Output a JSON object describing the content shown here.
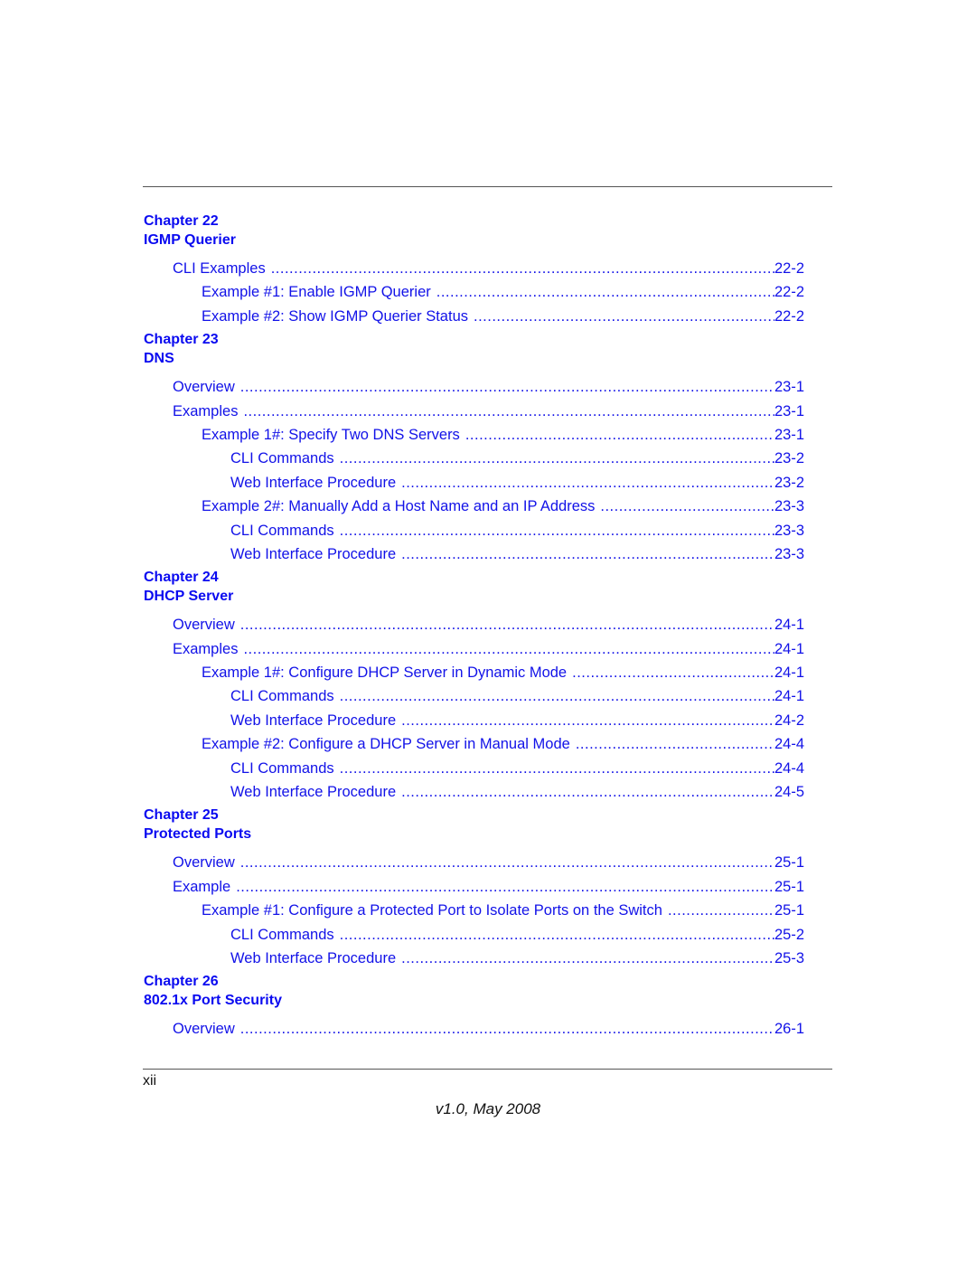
{
  "chapters": [
    {
      "chapter_label": "Chapter 22",
      "title": "IGMP Querier",
      "entries": [
        {
          "level": 1,
          "label": "CLI Examples",
          "page": "22-2"
        },
        {
          "level": 2,
          "label": "Example #1: Enable IGMP Querier",
          "page": "22-2"
        },
        {
          "level": 2,
          "label": "Example #2: Show IGMP Querier Status",
          "page": "22-2"
        }
      ]
    },
    {
      "chapter_label": "Chapter 23",
      "title": "DNS",
      "entries": [
        {
          "level": 1,
          "label": "Overview",
          "page": "23-1"
        },
        {
          "level": 1,
          "label": "Examples",
          "page": "23-1"
        },
        {
          "level": 2,
          "label": "Example 1#: Specify Two DNS Servers",
          "page": "23-1"
        },
        {
          "level": 3,
          "label": "CLI Commands",
          "page": "23-2"
        },
        {
          "level": 3,
          "label": "Web Interface Procedure",
          "page": "23-2"
        },
        {
          "level": 2,
          "label": "Example 2#: Manually Add a Host Name and an IP Address",
          "page": "23-3"
        },
        {
          "level": 3,
          "label": "CLI Commands",
          "page": "23-3"
        },
        {
          "level": 3,
          "label": "Web Interface Procedure",
          "page": "23-3"
        }
      ]
    },
    {
      "chapter_label": "Chapter 24",
      "title": "DHCP Server",
      "entries": [
        {
          "level": 1,
          "label": "Overview",
          "page": "24-1"
        },
        {
          "level": 1,
          "label": "Examples",
          "page": "24-1"
        },
        {
          "level": 2,
          "label": "Example 1#: Configure DHCP Server in Dynamic Mode",
          "page": "24-1"
        },
        {
          "level": 3,
          "label": "CLI Commands",
          "page": "24-1"
        },
        {
          "level": 3,
          "label": "Web Interface Procedure",
          "page": "24-2"
        },
        {
          "level": 2,
          "label": "Example #2: Configure a DHCP Server in Manual Mode",
          "page": "24-4"
        },
        {
          "level": 3,
          "label": "CLI Commands",
          "page": "24-4"
        },
        {
          "level": 3,
          "label": "Web Interface Procedure",
          "page": "24-5"
        }
      ]
    },
    {
      "chapter_label": "Chapter 25",
      "title": "Protected Ports",
      "entries": [
        {
          "level": 1,
          "label": "Overview",
          "page": "25-1"
        },
        {
          "level": 1,
          "label": "Example",
          "page": "25-1"
        },
        {
          "level": 2,
          "label": "Example #1: Configure a Protected Port to Isolate Ports on the Switch",
          "page": "25-1"
        },
        {
          "level": 3,
          "label": "CLI Commands",
          "page": "25-2"
        },
        {
          "level": 3,
          "label": "Web Interface Procedure",
          "page": "25-3"
        }
      ]
    },
    {
      "chapter_label": "Chapter 26",
      "title": "802.1x Port Security",
      "entries": [
        {
          "level": 1,
          "label": "Overview",
          "page": "26-1"
        }
      ]
    }
  ],
  "page_number": "xii",
  "footer": "v1.0, May 2008",
  "colors": {
    "link": "#0a0af0",
    "text": "#111111",
    "rule": "#555555"
  }
}
